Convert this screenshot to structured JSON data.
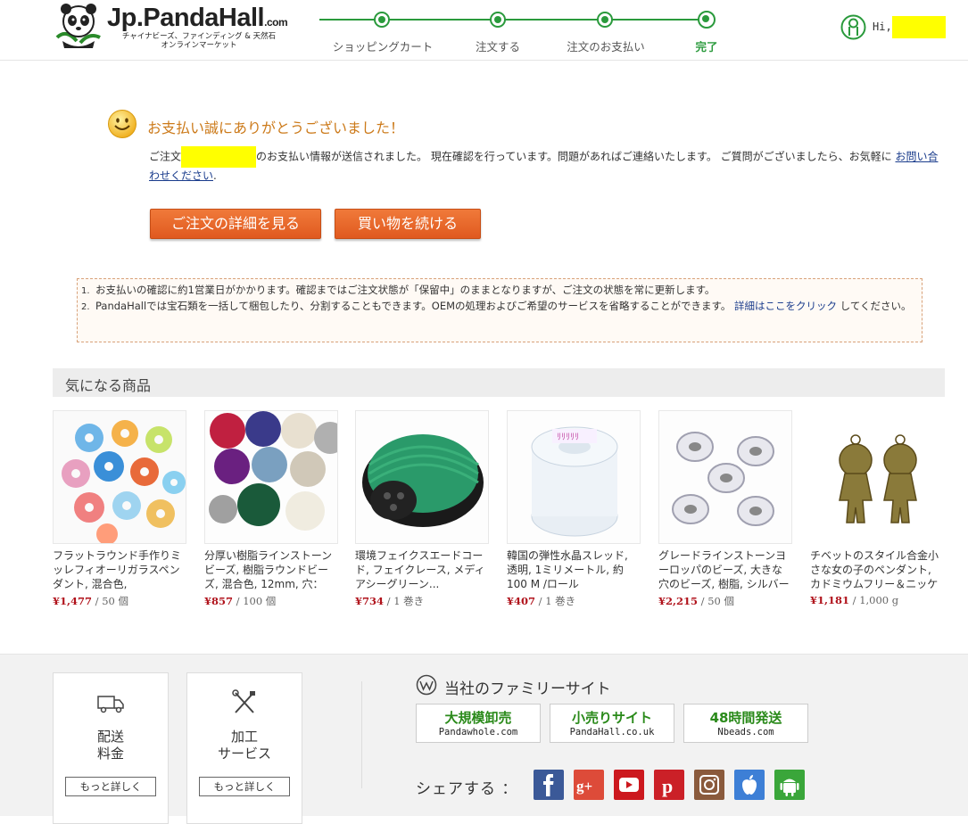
{
  "header": {
    "logo_text": "Jp.PandaHall",
    "logo_dotcom": ".com",
    "logo_sub1": "チャイナビーズ、ファインディング & 天然石",
    "logo_sub2": "オンラインマーケット",
    "steps": [
      {
        "label": "ショッピングカート"
      },
      {
        "label": "注文する"
      },
      {
        "label": "注文のお支払い"
      },
      {
        "label": "完了"
      }
    ],
    "hi_text": "Hi,"
  },
  "confirmation": {
    "title": "お支払い誠にありがとうございました！",
    "msg_prefix": "ご注文",
    "msg_body": "のお支払い情報が送信されました。 現在確認を行っています。問題があればご連絡いたします。 ご質問がございましたら、お気軽に",
    "contact_link": "お問い合わせください",
    "msg_end": ".",
    "btn_view_order": "ご注文の詳細を見る",
    "btn_continue": "買い物を続ける"
  },
  "notes": {
    "n1": "1.",
    "n2": "2.",
    "note1": "お支払いの確認に約1営業日がかかります。確認まではご注文状態が「保留中」のままとなりますが、ご注文の状態を常に更新します。",
    "note2_a": "PandaHallでは宝石類を一括して梱包したり、分割することもできます。OEMの処理およびご希望のサービスを省略することができます。",
    "note2_link": "詳細はここをクリック",
    "note2_b": "してください。"
  },
  "recommendations": {
    "title": "気になる商品",
    "products": [
      {
        "name": "フラットラウンド手作りミッレフィオーリガラスペンダント, 混合色,",
        "price": "¥1,477",
        "unit": " / 50 個"
      },
      {
        "name": "分厚い樹脂ラインストーンビーズ, 樹脂ラウンドビーズ, 混合色, 12mm, 穴：",
        "price": "¥857",
        "unit": " / 100 個"
      },
      {
        "name": "環境フェイクスエードコード, フェイクレース, メディアシーグリーン...",
        "price": "¥734",
        "unit": " / 1 巻き"
      },
      {
        "name": "韓国の弾性水晶スレッド, 透明, 1ミリメートル, 約100 M /ロール",
        "price": "¥407",
        "unit": " / 1 巻き"
      },
      {
        "name": "グレードラインストーンヨーロッパのビーズ, 大きな穴のビーズ, 樹脂, シルバー",
        "price": "¥2,215",
        "unit": " / 50 個"
      },
      {
        "name": "チベットのスタイル合金小さな女の子のペンダント, カドミウムフリー＆ニッケ",
        "price": "¥1,181",
        "unit": " / 1,000 g"
      }
    ]
  },
  "footer": {
    "shipping_title1": "配送",
    "shipping_title2": "料金",
    "shipping_btn": "もっと詳しく",
    "processing_title1": "加工",
    "processing_title2": "サービス",
    "processing_btn": "もっと詳しく",
    "family_title": "当社のファミリーサイト",
    "sites": [
      {
        "main": "大規模卸売",
        "sub": "Pandawhole.com"
      },
      {
        "main": "小売りサイト",
        "sub": "PandaHall.co.uk"
      },
      {
        "main": "48時間発送",
        "sub": "Nbeads.com"
      }
    ],
    "share_label": "シェアする ：",
    "social_colors": {
      "facebook": "#3b5998",
      "googleplus": "#dd4b39",
      "youtube": "#cc181e",
      "pinterest": "#cb2027",
      "instagram": "#8a5a3c",
      "apple": "#3d7fd6",
      "android": "#3aa63a"
    }
  }
}
